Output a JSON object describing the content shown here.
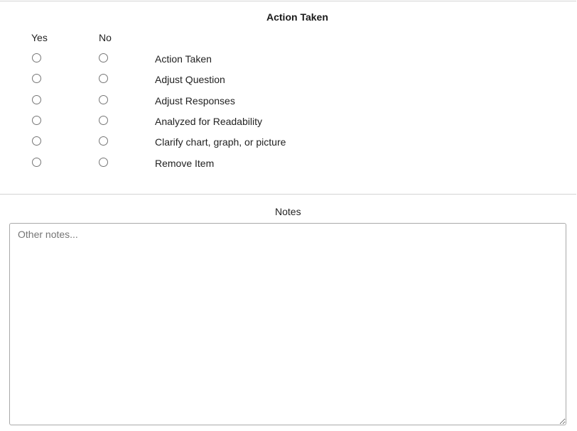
{
  "action_section": {
    "title": "Action Taken",
    "columns": {
      "yes": "Yes",
      "no": "No"
    },
    "rows": [
      {
        "label": "Action Taken"
      },
      {
        "label": "Adjust Question"
      },
      {
        "label": "Adjust Responses"
      },
      {
        "label": "Analyzed for Readability"
      },
      {
        "label": "Clarify chart, graph, or picture"
      },
      {
        "label": "Remove Item"
      }
    ]
  },
  "notes_section": {
    "title": "Notes",
    "placeholder": "Other notes...",
    "value": ""
  }
}
